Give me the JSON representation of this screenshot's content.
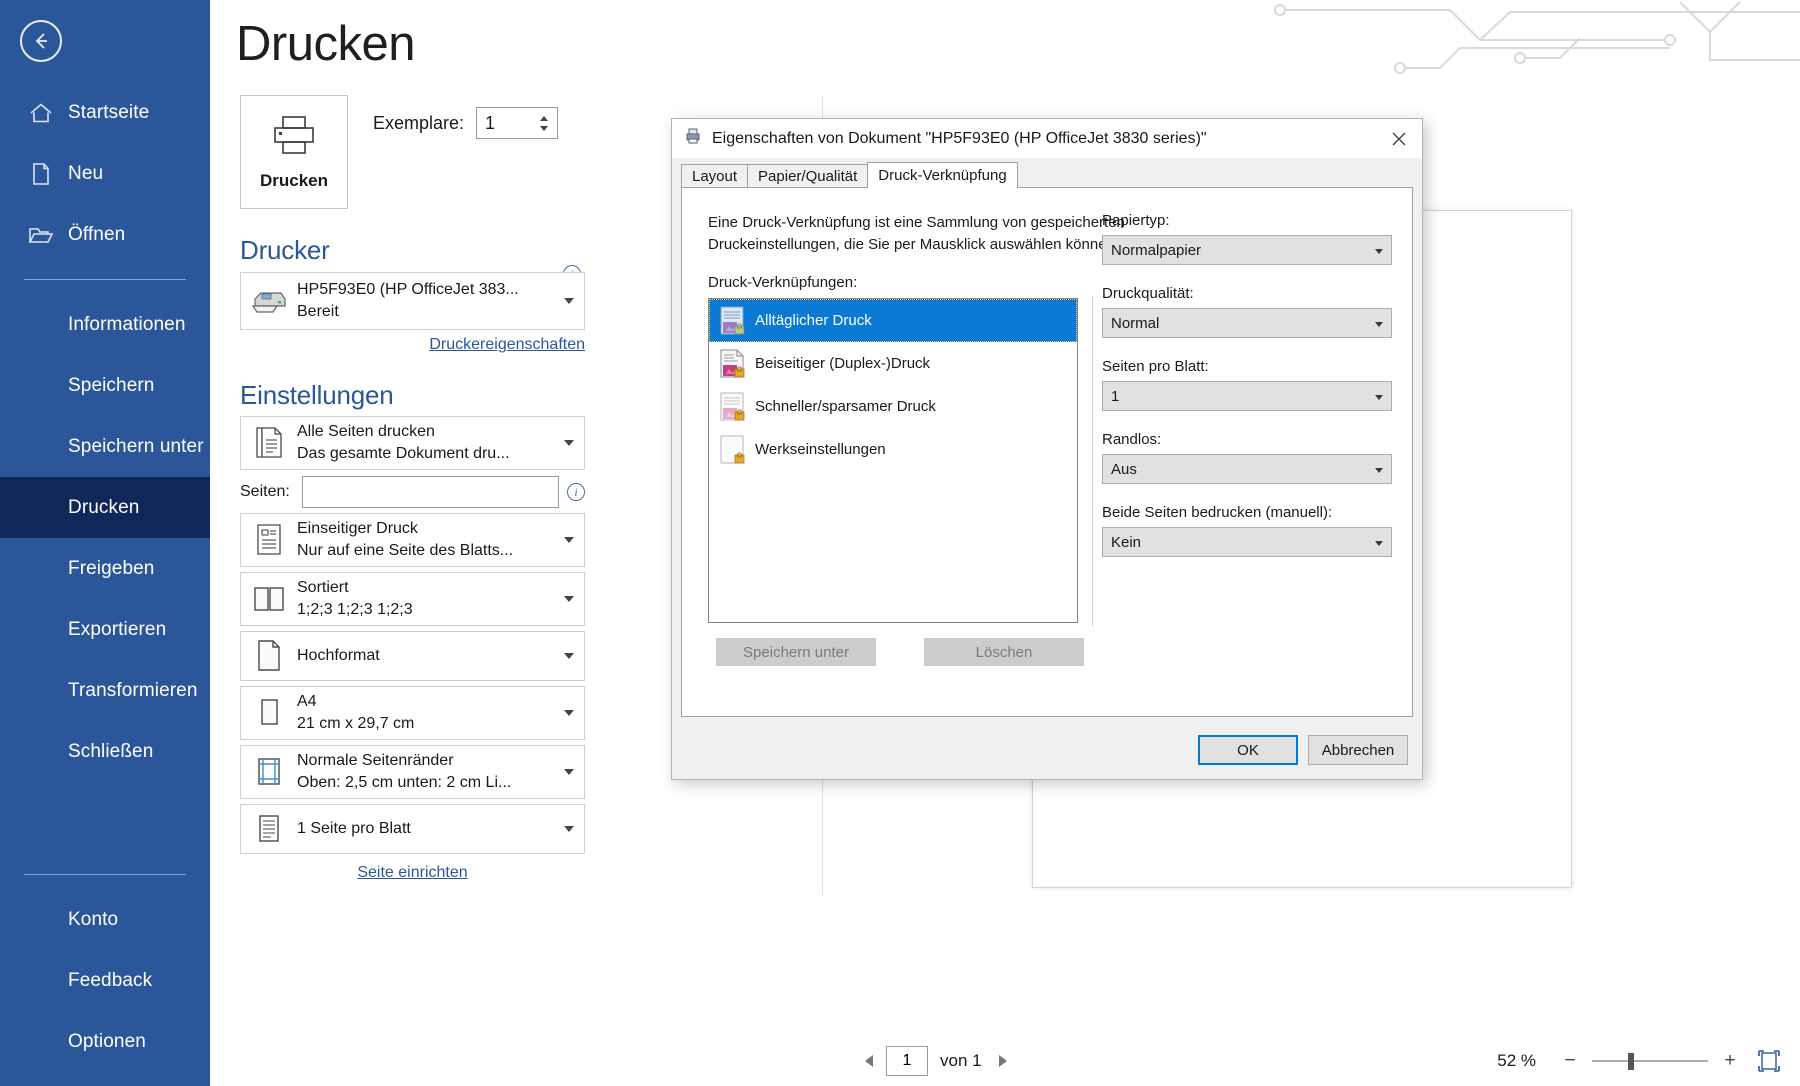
{
  "sidebar": {
    "back_icon": "back-arrow-icon",
    "top_items": [
      {
        "label": "Startseite",
        "icon": "home-icon"
      },
      {
        "label": "Neu",
        "icon": "new-document-icon"
      },
      {
        "label": "Öffnen",
        "icon": "open-folder-icon"
      }
    ],
    "mid_items": [
      {
        "label": "Informationen",
        "active": false
      },
      {
        "label": "Speichern",
        "active": false
      },
      {
        "label": "Speichern unter",
        "active": false
      },
      {
        "label": "Drucken",
        "active": true
      },
      {
        "label": "Freigeben",
        "active": false
      },
      {
        "label": "Exportieren",
        "active": false
      },
      {
        "label": "Transformieren",
        "active": false
      },
      {
        "label": "Schließen",
        "active": false
      }
    ],
    "bottom_items": [
      {
        "label": "Konto"
      },
      {
        "label": "Feedback"
      },
      {
        "label": "Optionen"
      }
    ],
    "accent_color": "#2b579a",
    "active_color": "#10275a"
  },
  "backstage": {
    "title": "Drucken",
    "print_button": {
      "label": "Drucken",
      "icon": "printer-icon"
    },
    "copies": {
      "label": "Exemplare:",
      "value": "1"
    },
    "printer_section": {
      "heading": "Drucker",
      "info_icon": "info-icon",
      "name": "HP5F93E0 (HP OfficeJet 383...",
      "status": "Bereit",
      "properties_link": "Druckereigenschaften"
    },
    "settings_section": {
      "heading": "Einstellungen",
      "options": [
        {
          "icon": "all-pages-icon",
          "primary": "Alle Seiten drucken",
          "secondary": "Das gesamte Dokument dru..."
        },
        {
          "icon": "one-sided-icon",
          "primary": "Einseitiger Druck",
          "secondary": "Nur auf eine Seite des Blatts..."
        },
        {
          "icon": "collate-icon",
          "primary": "Sortiert",
          "secondary": "1;2;3    1;2;3    1;2;3"
        },
        {
          "icon": "portrait-icon",
          "primary": "Hochformat",
          "secondary": ""
        },
        {
          "icon": "paper-size-icon",
          "primary": "A4",
          "secondary": "21 cm x 29,7 cm"
        },
        {
          "icon": "margins-icon",
          "primary": "Normale Seitenränder",
          "secondary": "Oben: 2,5 cm unten: 2 cm Li..."
        },
        {
          "icon": "pages-per-sheet-icon",
          "primary": "1 Seite pro Blatt",
          "secondary": ""
        }
      ],
      "pages_label": "Seiten:",
      "pages_value": "",
      "pages_info_icon": "info-icon",
      "setup_link": "Seite einrichten"
    }
  },
  "statusbar": {
    "prev_icon": "prev-page-icon",
    "next_icon": "next-page-icon",
    "page_value": "1",
    "page_of": "von 1",
    "zoom_percent": "52 %",
    "zoom_out": "−",
    "zoom_in": "+",
    "fit_icon": "fit-to-page-icon"
  },
  "dialog": {
    "title": "Eigenschaften von Dokument \"HP5F93E0 (HP OfficeJet 3830 series)\"",
    "title_icon": "printer-properties-icon",
    "close_icon": "close-icon",
    "tabs": [
      {
        "label": "Layout",
        "active": false
      },
      {
        "label": "Papier/Qualität",
        "active": false
      },
      {
        "label": "Druck-Verknüpfung",
        "active": true
      }
    ],
    "description_line1": "Eine Druck-Verknüpfung ist eine Sammlung von gespeicherten",
    "description_line2": "Druckeinstellungen, die Sie per Mausklick auswählen können",
    "list_label": "Druck-Verknüpfungen:",
    "shortcuts": [
      {
        "label": "Alltäglicher Druck",
        "selected": true,
        "icon": "shortcut-everyday-icon"
      },
      {
        "label": "Beiseitiger (Duplex-)Druck",
        "selected": false,
        "icon": "shortcut-duplex-icon"
      },
      {
        "label": "Schneller/sparsamer Druck",
        "selected": false,
        "icon": "shortcut-economy-icon"
      },
      {
        "label": "Werkseinstellungen",
        "selected": false,
        "icon": "shortcut-factory-icon"
      }
    ],
    "save_as_button": "Speichern unter",
    "delete_button": "Löschen",
    "fields": [
      {
        "label": "Papiertyp:",
        "value": "Normalpapier"
      },
      {
        "label": "Druckqualität:",
        "value": "Normal"
      },
      {
        "label": "Seiten pro Blatt:",
        "value": "1"
      },
      {
        "label": "Randlos:",
        "value": "Aus"
      },
      {
        "label": "Beide Seiten bedrucken (manuell):",
        "value": "Kein"
      }
    ],
    "ok_button": "OK",
    "cancel_button": "Abbrechen",
    "selection_color": "#0b7ad4"
  }
}
